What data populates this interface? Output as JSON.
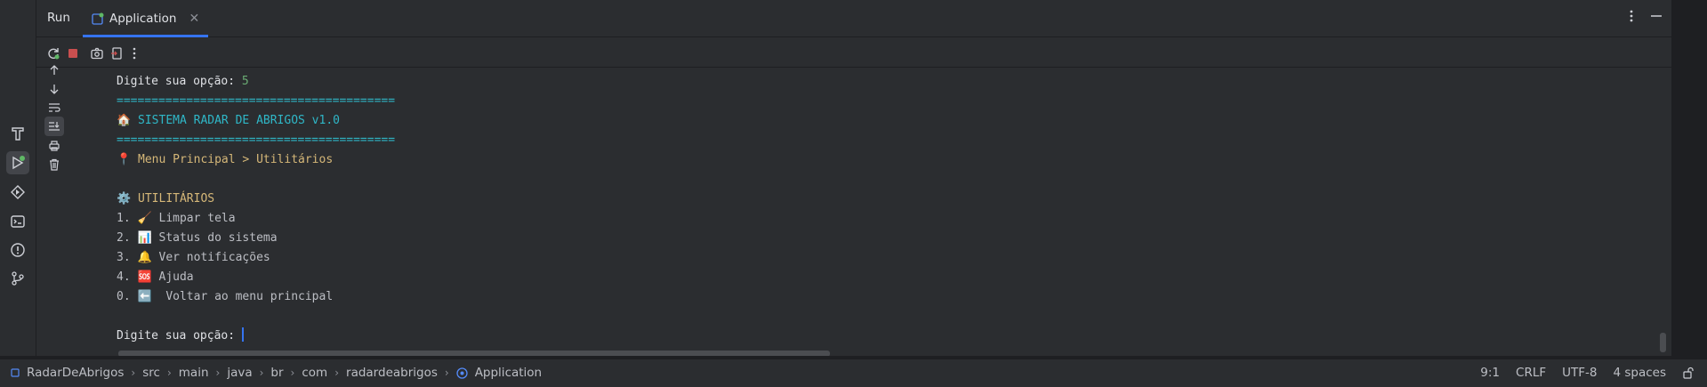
{
  "run_tool": {
    "title": "Run",
    "tab": {
      "label": "Application",
      "close_icon": "close-icon"
    }
  },
  "toolbar": {
    "rerun_icon": "rerun-icon",
    "stop_icon": "stop-icon",
    "screenshot_icon": "camera-icon",
    "exit_icon": "exit-icon",
    "more_icon": "more-vertical-icon"
  },
  "console": {
    "lines": [
      {
        "text": "Digite sua opção: ",
        "value": "5"
      },
      {
        "text": "\u001b========================================"
      },
      {
        "text": "🏠 SISTEMA RADAR DE ABRIGOS v1.0"
      },
      {
        "text": "========================================"
      },
      {
        "text": "📍 Menu Principal > Utilitários"
      },
      {
        "text": ""
      },
      {
        "text": "⚙️ UTILITÁRIOS"
      },
      {
        "text": "1. 🧹 Limpar tela"
      },
      {
        "text": "2. 📊 Status do sistema"
      },
      {
        "text": "3. 🔔 Ver notificações"
      },
      {
        "text": "4. 🆘 Ajuda"
      },
      {
        "text": "0. ⬅️  Voltar ao menu principal"
      },
      {
        "text": ""
      },
      {
        "text": "Digite sua opção: "
      }
    ]
  },
  "statusbar": {
    "breadcrumbs": [
      "RadarDeAbrigos",
      "src",
      "main",
      "java",
      "br",
      "com",
      "radardeabrigos",
      "Application"
    ],
    "position": "9:1",
    "line_separator": "CRLF",
    "encoding": "UTF-8",
    "indent": "4 spaces"
  },
  "colors": {
    "accent": "#3574f0",
    "background": "#2b2d30",
    "green": "#6aab73",
    "cyan": "#2fb7c7",
    "yellow": "#d5b778"
  }
}
